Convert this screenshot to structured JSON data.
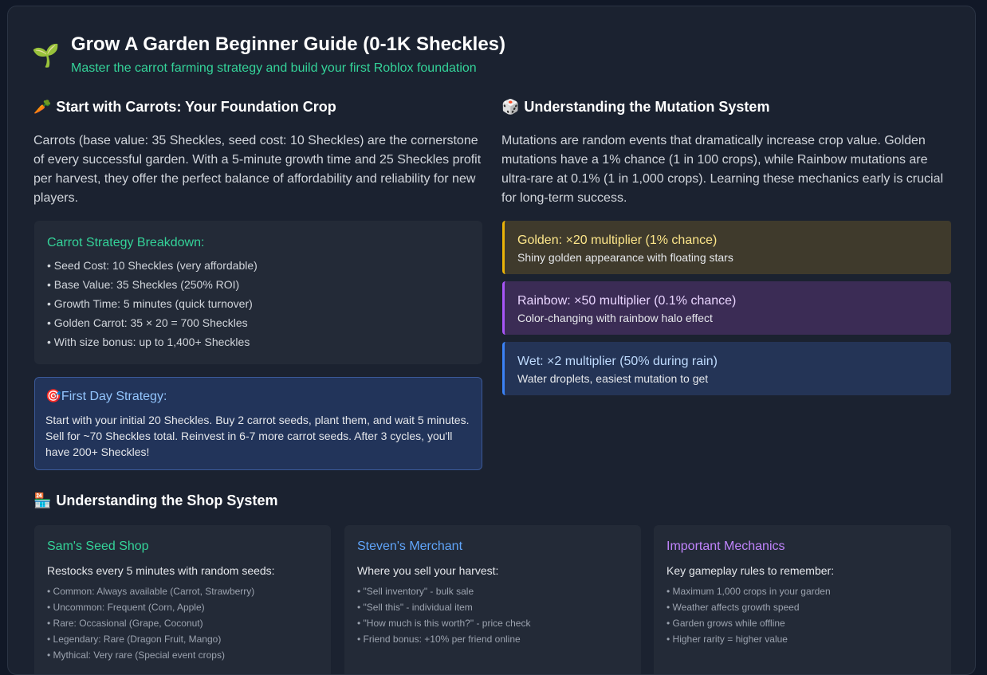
{
  "header": {
    "icon": "🌱",
    "title": "Grow A Garden Beginner Guide (0-1K Sheckles)",
    "subtitle": "Master the carrot farming strategy and build your first Roblox foundation"
  },
  "carrots": {
    "emoji": "🥕",
    "title": "Start with Carrots: Your Foundation Crop",
    "paragraph": "Carrots (base value: 35 Sheckles, seed cost: 10 Sheckles) are the cornerstone of every successful garden. With a 5-minute growth time and 25 Sheckles profit per harvest, they offer the perfect balance of affordability and reliability for new players.",
    "breakdown": {
      "title": "Carrot Strategy Breakdown:",
      "items": [
        "Seed Cost: 10 Sheckles (very affordable)",
        "Base Value: 35 Sheckles (250% ROI)",
        "Growth Time: 5 minutes (quick turnover)",
        "Golden Carrot: 35 × 20 = 700 Sheckles",
        "With size bonus: up to 1,400+ Sheckles"
      ]
    },
    "first_day": {
      "emoji": "🎯",
      "title": "First Day Strategy:",
      "text": "Start with your initial 20 Sheckles. Buy 2 carrot seeds, plant them, and wait 5 minutes. Sell for ~70 Sheckles total. Reinvest in 6-7 more carrot seeds. After 3 cycles, you'll have 200+ Sheckles!"
    }
  },
  "mutations": {
    "emoji": "🎲",
    "title": "Understanding the Mutation System",
    "paragraph": "Mutations are random events that dramatically increase crop value. Golden mutations have a 1% chance (1 in 100 crops), while Rainbow mutations are ultra-rare at 0.1% (1 in 1,000 crops). Learning these mechanics early is crucial for long-term success.",
    "items": [
      {
        "title": "Golden: ×20 multiplier (1% chance)",
        "desc": "Shiny golden appearance with floating stars",
        "accent": "#eab308",
        "bg": "#3f3a2c",
        "title_color": "#fde68a"
      },
      {
        "title": "Rainbow: ×50 multiplier (0.1% chance)",
        "desc": "Color-changing with rainbow halo effect",
        "accent": "#a855f7",
        "bg": "#3b2c55",
        "title_color": "#e9d5ff"
      },
      {
        "title": "Wet: ×2 multiplier (50% during rain)",
        "desc": "Water droplets, easiest mutation to get",
        "accent": "#3b82f6",
        "bg": "#243456",
        "title_color": "#bfdbfe"
      }
    ]
  },
  "shop": {
    "emoji": "🏪",
    "title": "Understanding the Shop System",
    "cards": [
      {
        "title": "Sam's Seed Shop",
        "color": "#34d399",
        "desc": "Restocks every 5 minutes with random seeds:",
        "items": [
          "Common: Always available (Carrot, Strawberry)",
          "Uncommon: Frequent (Corn, Apple)",
          "Rare: Occasional (Grape, Coconut)",
          "Legendary: Rare (Dragon Fruit, Mango)",
          "Mythical: Very rare (Special event crops)"
        ]
      },
      {
        "title": "Steven's Merchant",
        "color": "#60a5fa",
        "desc": "Where you sell your harvest:",
        "items": [
          "\"Sell inventory\" - bulk sale",
          "\"Sell this\" - individual item",
          "\"How much is this worth?\" - price check",
          "Friend bonus: +10% per friend online"
        ]
      },
      {
        "title": "Important Mechanics",
        "color": "#c084fc",
        "desc": "Key gameplay rules to remember:",
        "items": [
          "Maximum 1,000 crops in your garden",
          "Weather affects growth speed",
          "Garden grows while offline",
          "Higher rarity = higher value"
        ]
      }
    ]
  }
}
